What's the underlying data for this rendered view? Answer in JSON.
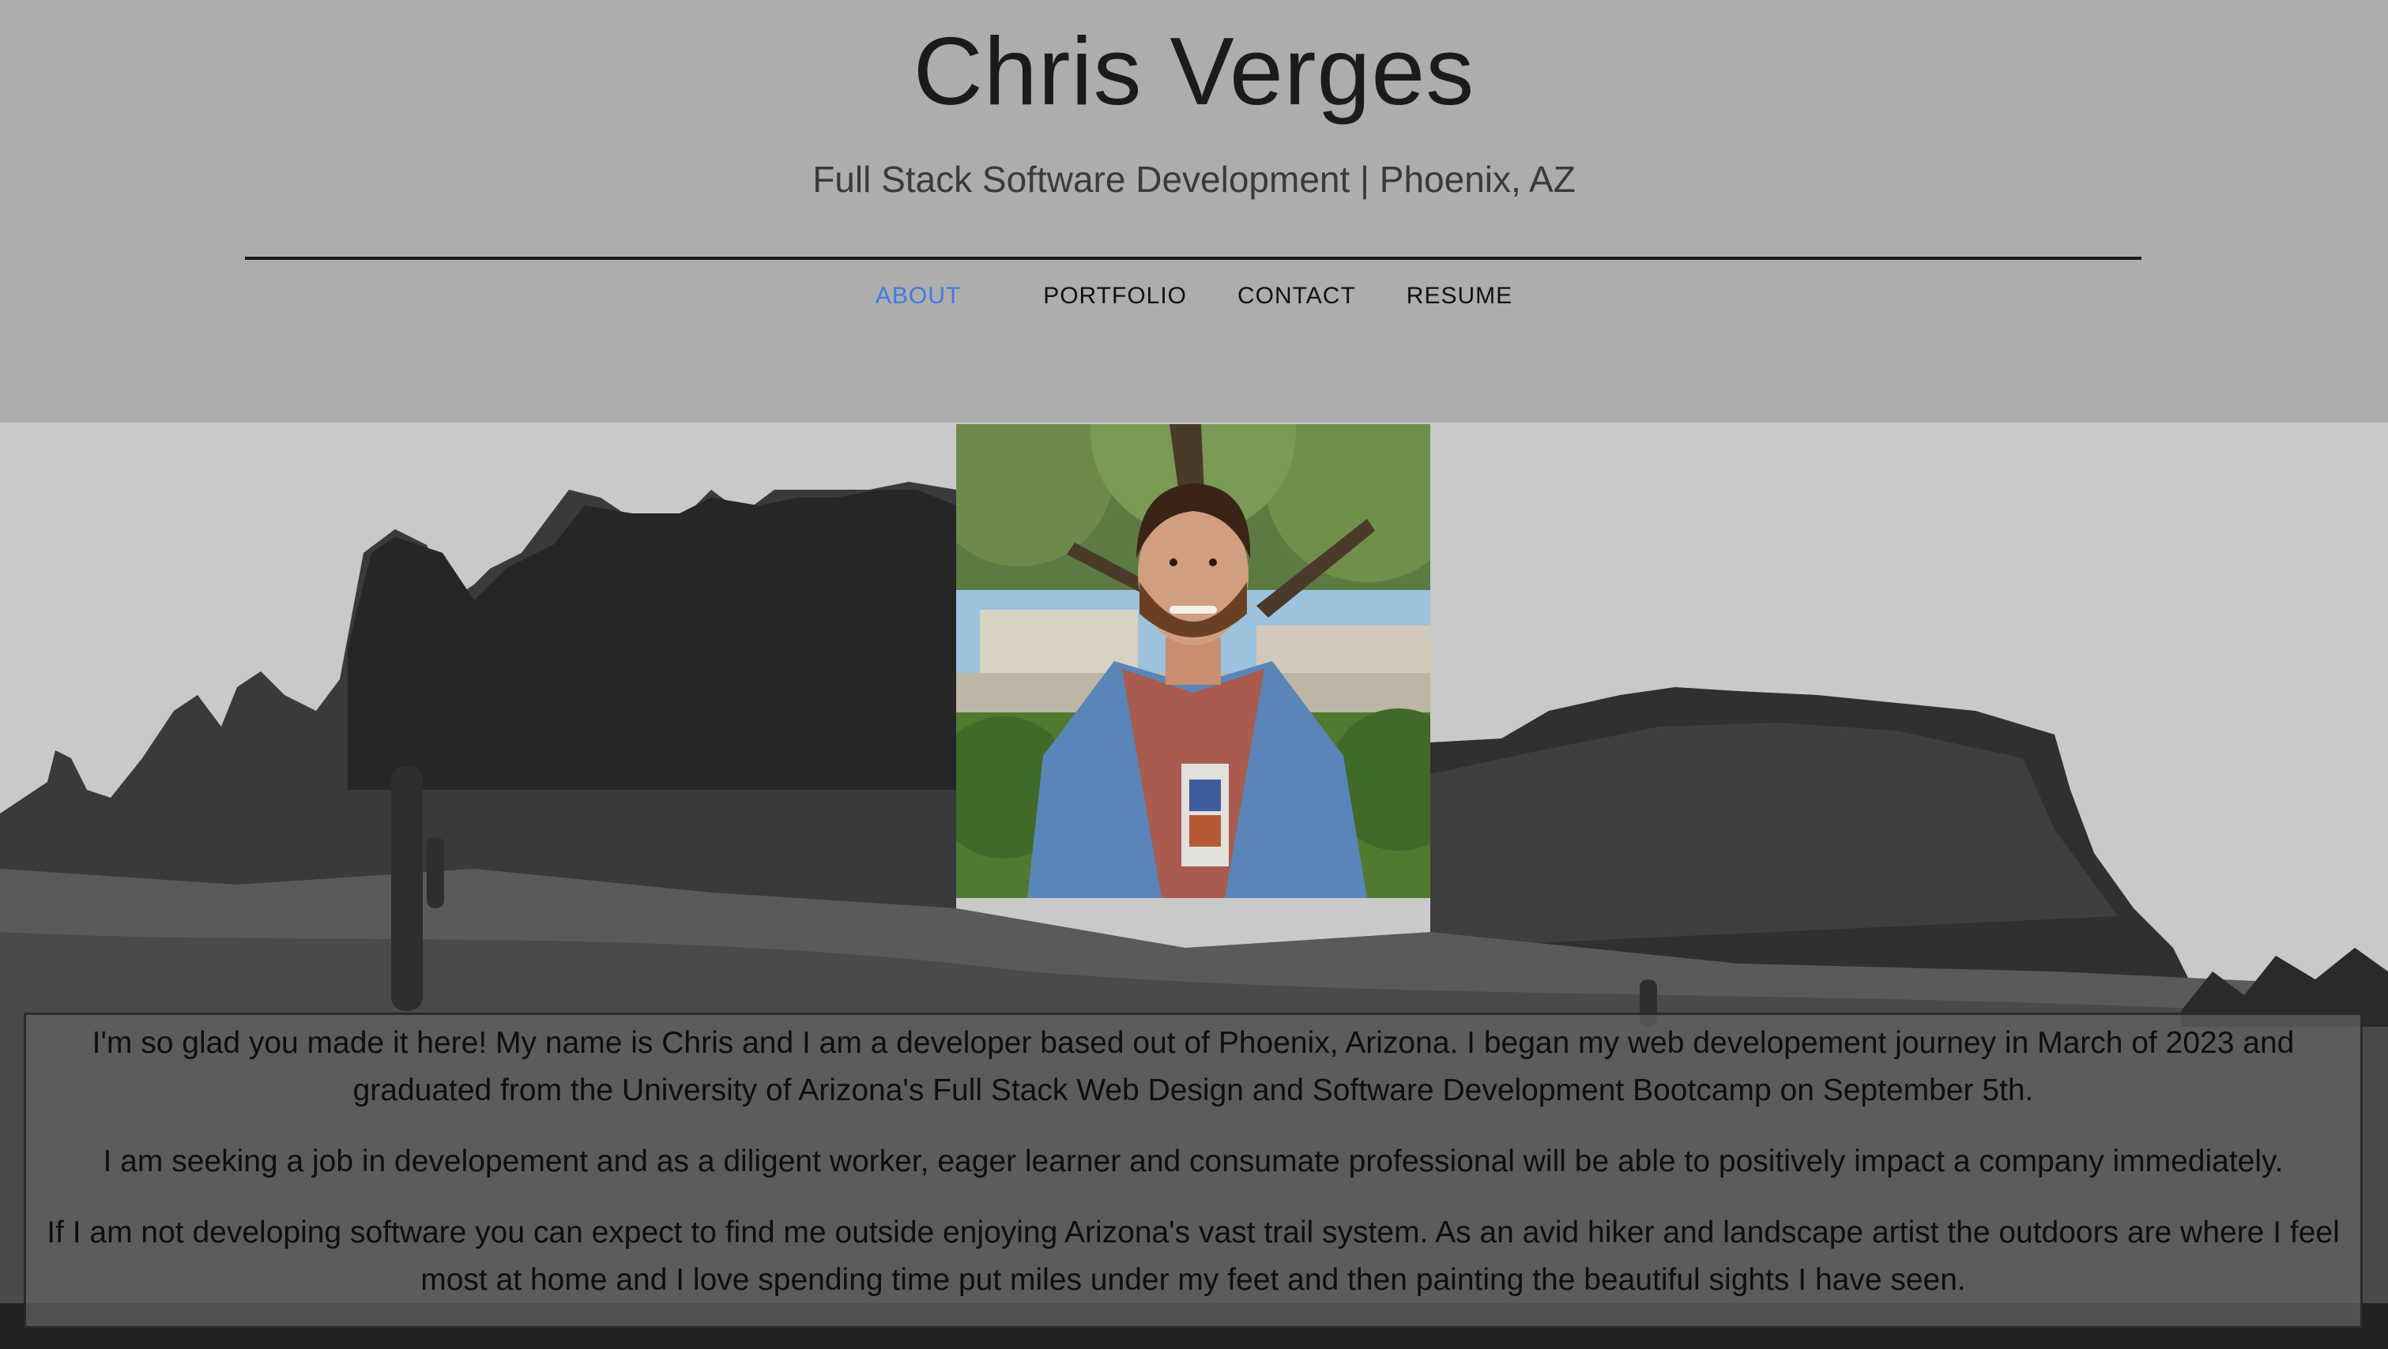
{
  "header": {
    "title": "Chris Verges",
    "subtitle": "Full Stack Software Development | Phoenix, AZ"
  },
  "nav": {
    "items": [
      "ABOUT",
      "PORTFOLIO",
      "CONTACT",
      "RESUME"
    ],
    "active": "ABOUT",
    "active_color": "#3f7be0"
  },
  "about": {
    "paragraphs": [
      "I'm so glad you made it here! My name is Chris and I am a developer based out of Phoenix, Arizona. I began my web developement journey in March of 2023 and graduated from the University of Arizona's Full Stack Web Design and Software Development Bootcamp on September 5th.",
      "I am seeking a job in developement and as a diligent worker, eager learner and consumate professional will be able to positively impact a company immediately.",
      "If I am not developing software you can expect to find me outside enjoying Arizona's vast trail system. As an avid hiker and landscape artist the outdoors are where I feel most at home and I love spending time put miles under my feet and then painting the beautiful sights I have seen."
    ]
  }
}
